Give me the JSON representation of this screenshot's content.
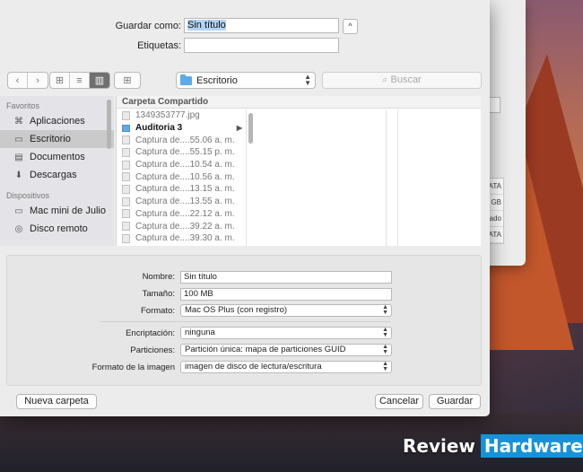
{
  "save_as": {
    "label": "Guardar como:",
    "value": "Sin título"
  },
  "tags": {
    "label": "Etiquetas:",
    "value": ""
  },
  "disclosure": {
    "glyph": "^"
  },
  "toolbar": {
    "back_glyph": "‹",
    "forward_glyph": "›",
    "view_icons_glyph": "⊞",
    "view_list_glyph": "≡",
    "view_columns_glyph": "▥",
    "arrange_glyph": "⊞",
    "location": "Escritorio",
    "search_placeholder": "Buscar"
  },
  "sidebar": {
    "favorites_header": "Favoritos",
    "favorites": [
      {
        "label": "Aplicaciones",
        "icon": "apps-icon",
        "glyph": "⌘"
      },
      {
        "label": "Escritorio",
        "icon": "desktop-icon",
        "glyph": "▭"
      },
      {
        "label": "Documentos",
        "icon": "documents-icon",
        "glyph": "▤"
      },
      {
        "label": "Descargas",
        "icon": "downloads-icon",
        "glyph": "⬇"
      }
    ],
    "devices_header": "Dispositivos",
    "devices": [
      {
        "label": "Mac mini de Julio",
        "icon": "computer-icon",
        "glyph": "▭"
      },
      {
        "label": "Disco remoto",
        "icon": "disc-icon",
        "glyph": "◎"
      }
    ]
  },
  "browser": {
    "column_header": "Carpeta Compartido",
    "files": [
      {
        "name": "1349353777.jpg",
        "folder": false
      },
      {
        "name": "Auditoria 3",
        "folder": true
      },
      {
        "name": "Captura de....55.06 a. m.",
        "folder": false
      },
      {
        "name": "Captura de....55.15 p. m.",
        "folder": false
      },
      {
        "name": "Captura de....10.54 a. m.",
        "folder": false
      },
      {
        "name": "Captura de....10.56 a. m.",
        "folder": false
      },
      {
        "name": "Captura de....13.15 a. m.",
        "folder": false
      },
      {
        "name": "Captura de....13.55 a. m.",
        "folder": false
      },
      {
        "name": "Captura de....22.12 a. m.",
        "folder": false
      },
      {
        "name": "Captura de....39.22 a. m.",
        "folder": false
      },
      {
        "name": "Captura de....39.30 a. m.",
        "folder": false
      }
    ],
    "chevron_glyph": "▶"
  },
  "disk_options": {
    "name_label": "Nombre:",
    "name_value": "Sin título",
    "size_label": "Tamaño:",
    "size_value": "100 MB",
    "format_label": "Formato:",
    "format_value": "Mac OS Plus (con registro)",
    "encryption_label": "Encriptación:",
    "encryption_value": "ninguna",
    "partitions_label": "Particiones:",
    "partitions_value": "Partición única: mapa de particiones GUID",
    "image_format_label": "Formato de la imagen",
    "image_format_value": "imagen de disco de lectura/escritura"
  },
  "buttons": {
    "new_folder": "Nueva carpeta",
    "cancel": "Cancelar",
    "save": "Guardar"
  },
  "background_window": {
    "cells": [
      "ATA",
      "GB",
      "ado",
      "ATA"
    ]
  },
  "watermark": {
    "review": "Review",
    "hardware": "Hardware"
  },
  "colors": {
    "accent": "#1593d8",
    "folder": "#5fa9e6",
    "selection": "#b4d3f5"
  }
}
